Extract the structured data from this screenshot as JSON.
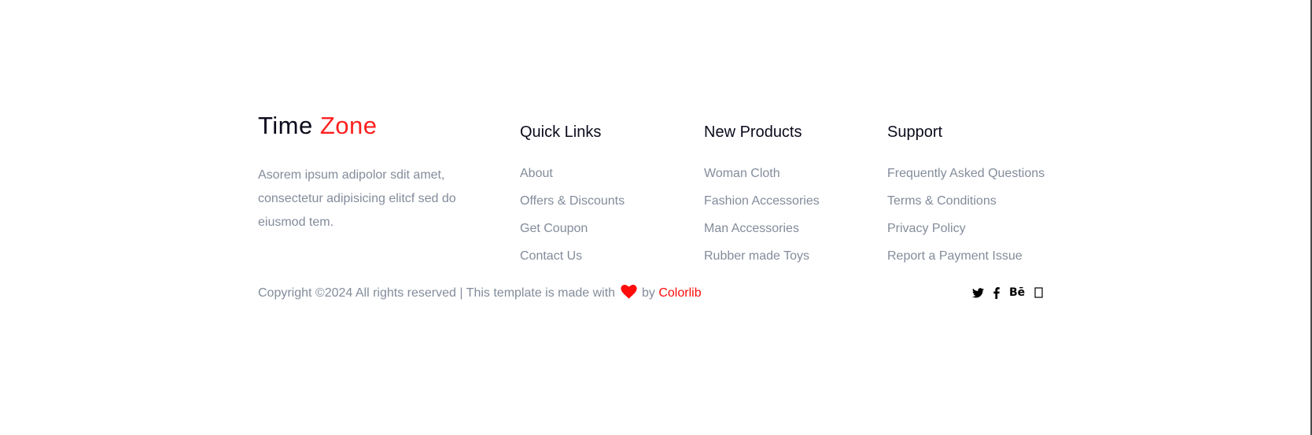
{
  "logo": {
    "part1": "Time",
    "part2": "Zone"
  },
  "about": {
    "text": "Asorem ipsum adipolor sdit amet, consectetur adipisicing elitcf sed do eiusmod tem."
  },
  "columns": [
    {
      "title": "Quick Links",
      "items": [
        "About",
        "Offers & Discounts",
        "Get Coupon",
        "Contact Us"
      ]
    },
    {
      "title": "New Products",
      "items": [
        "Woman Cloth",
        "Fashion Accessories",
        "Man Accessories",
        "Rubber made Toys"
      ]
    },
    {
      "title": "Support",
      "items": [
        "Frequently Asked Questions",
        "Terms & Conditions",
        "Privacy Policy",
        "Report a Payment Issue"
      ]
    }
  ],
  "copyright": {
    "prefix": "Copyright ©2024 All rights reserved | This template is made with",
    "by": "by",
    "brand": "Colorlib"
  },
  "social": {
    "icons": [
      "twitter-icon",
      "facebook-icon",
      "behance-icon",
      "globe-icon"
    ],
    "behance_glyph": "Bē"
  },
  "colors": {
    "accent": "#ff2020",
    "text_muted": "#838c9b",
    "heading": "#0b0b1d"
  }
}
